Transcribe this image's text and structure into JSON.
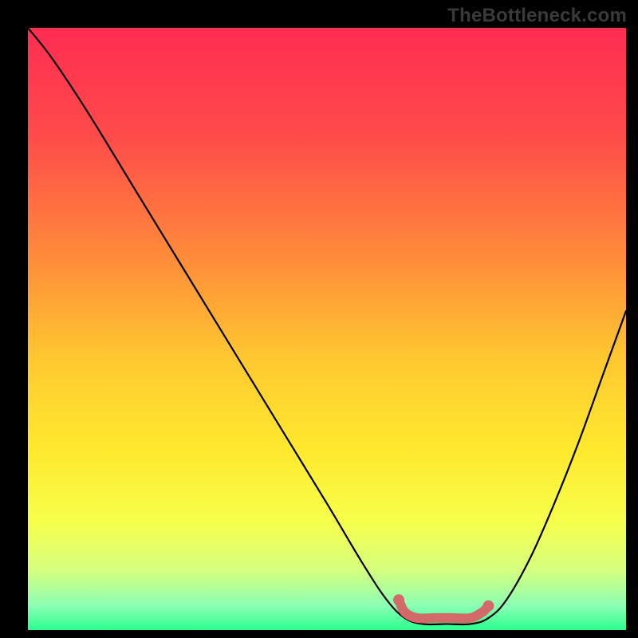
{
  "watermark": "TheBottleneck.com",
  "chart_data": {
    "type": "line",
    "title": "",
    "xlabel": "",
    "ylabel": "",
    "xlim": [
      0,
      100
    ],
    "ylim": [
      0,
      100
    ],
    "gradient_stops": [
      {
        "offset": 0,
        "color": "#ff2c52"
      },
      {
        "offset": 18,
        "color": "#ff4b4a"
      },
      {
        "offset": 38,
        "color": "#ff8b3a"
      },
      {
        "offset": 55,
        "color": "#ffc830"
      },
      {
        "offset": 70,
        "color": "#ffe92e"
      },
      {
        "offset": 82,
        "color": "#f7ff4a"
      },
      {
        "offset": 90,
        "color": "#d6ff7e"
      },
      {
        "offset": 96,
        "color": "#8bffb4"
      },
      {
        "offset": 100,
        "color": "#2bff8e"
      }
    ],
    "series": [
      {
        "name": "bottleneck-curve",
        "stroke": "#000000",
        "points": [
          {
            "x": 0,
            "y": 100
          },
          {
            "x": 4,
            "y": 95
          },
          {
            "x": 10,
            "y": 86
          },
          {
            "x": 18,
            "y": 73
          },
          {
            "x": 26,
            "y": 60
          },
          {
            "x": 34,
            "y": 47
          },
          {
            "x": 42,
            "y": 34
          },
          {
            "x": 50,
            "y": 21
          },
          {
            "x": 56,
            "y": 11
          },
          {
            "x": 60,
            "y": 5
          },
          {
            "x": 63,
            "y": 2
          },
          {
            "x": 66,
            "y": 1
          },
          {
            "x": 70,
            "y": 1
          },
          {
            "x": 74,
            "y": 1
          },
          {
            "x": 77,
            "y": 2
          },
          {
            "x": 80,
            "y": 5
          },
          {
            "x": 84,
            "y": 12
          },
          {
            "x": 88,
            "y": 21
          },
          {
            "x": 92,
            "y": 31
          },
          {
            "x": 96,
            "y": 42
          },
          {
            "x": 100,
            "y": 53
          }
        ]
      },
      {
        "name": "optimal-range-marker",
        "stroke": "#d36a6a",
        "points": [
          {
            "x": 62,
            "y": 5
          },
          {
            "x": 63,
            "y": 3
          },
          {
            "x": 65,
            "y": 2
          },
          {
            "x": 68,
            "y": 2
          },
          {
            "x": 71,
            "y": 2
          },
          {
            "x": 74,
            "y": 2
          },
          {
            "x": 76,
            "y": 3
          },
          {
            "x": 77,
            "y": 4
          }
        ]
      }
    ],
    "markers": [
      {
        "name": "optimal-start",
        "x": 62,
        "y": 5,
        "color": "#d36a6a"
      },
      {
        "name": "optimal-end",
        "x": 77,
        "y": 4,
        "color": "#d36a6a"
      }
    ]
  }
}
